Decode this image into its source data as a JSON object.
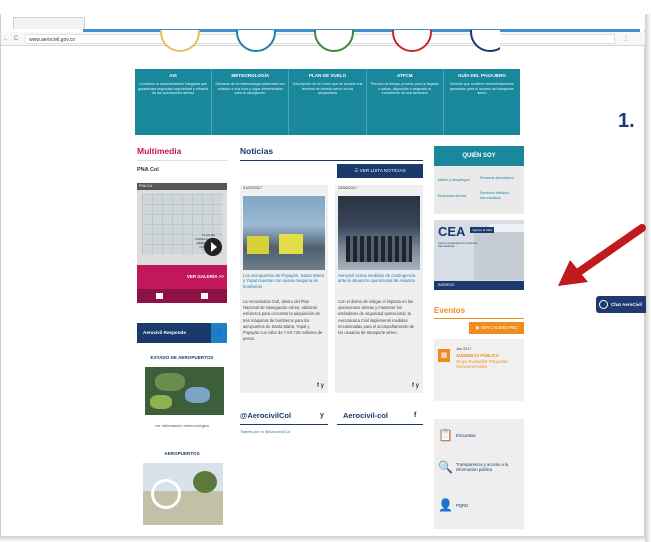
{
  "browser": {
    "url": "www.aerocivil.gov.co",
    "back_icon": "arrow-left",
    "refresh_icon": "refresh",
    "menu_icon": "vertical-dots"
  },
  "nav": [
    {
      "title": "AIS",
      "text": "Conforme la documentación integrada que garantizara seguridad regularidad y eficacia de las operaciones aéreas"
    },
    {
      "title": "METEOROLOGÍA",
      "text": "Destacar de la meteorología observada con relación a una hora y lugar determinados para la navegación."
    },
    {
      "title": "PLAN DE VUELO",
      "text": "Descripción de un vuelo que se somete a la terminal de tránsito aéreo en los aeropuertos"
    },
    {
      "title": "ATFCM",
      "text": "Período de tiempo previsto para la llegada o salida, disponible o asignado al movimiento de una aeronave"
    },
    {
      "title": "GUÍA DEL PASAJERO",
      "text": "Sección que contiene recomendaciones generales para el usuario del transporte aéreo"
    }
  ],
  "multimedia": {
    "title": "Multimedia",
    "subtitle": "PNA Col",
    "video_bar": "PNA Col",
    "video_caption": "PLAN DE NAVEGACIÓN AÉREA PARA COLOMBIA",
    "gallery_label": "VER GALERÍA >>"
  },
  "aerocivil_responde": "Aerocivil Responde",
  "estado": "ESTADO DE AEROPUERTOS",
  "ver_meteo": "ver información meteorológica",
  "aeropuertos": "AEROPUERTOS",
  "news": {
    "title": "Noticias",
    "button": "VER LISTA NOTICIAS",
    "items": [
      {
        "date": "01/03/2017",
        "headline": "Los aeropuertos de Popayán, Santa Marta y Yopal cuentan con nueva maquina de bomberos",
        "body": "La Aeronáutica Civil, dentro del Plan Nacional de Navegación Aérea, adelantó esfuerzos para concretar la adquisición de tres máquinas de bomberos para los aeropuertos de Santa Marta, Yopal y Popayán con valor de 7 mil 725 millones de pesos.",
        "share": "f y"
      },
      {
        "date": "23/06/2017",
        "headline": "Aerocivil activa medidas de contingencia ante la situación operacional de Avianca",
        "body": "Con el ánimo de mitigar el impacto en las operaciones aéreas y mantener los estándares de seguridad operacional, la Aeronáutica Civil implementó medidas encaminadas para el acompañamiento de los usuarios de transporte aéreo.",
        "share": "f y"
      }
    ]
  },
  "twitter": {
    "title": "@AerocivilCol",
    "sub": "Tweets por el @AerocivilCol",
    "icon": "y"
  },
  "facebook": {
    "title": "Aerocivil-col",
    "icon": "f"
  },
  "quien_soy": {
    "title": "QUIÉN SOY",
    "items": [
      "Misión y despliegue",
      "Personal aeronáutico",
      "Empresas Aéreas",
      "Servicios Médicos Aeronáuticos"
    ]
  },
  "cea": {
    "logo": "CEA",
    "tag": "Ingreso al CEA",
    "sub": "Centro de Estudios de Ciencias Aeronáuticas",
    "ingreso": "INGRESO"
  },
  "eventos": {
    "title": "Eventos",
    "button": "VER CALENDARIO",
    "date": "Jan 2017",
    "t1": "AUDIENCIA PÚBLICA",
    "t2": "Grupo Evaluador Proyectos Aerocomerciales"
  },
  "links": [
    {
      "text": "Encuestas"
    },
    {
      "text": "Transparencia y acceso a la información pública"
    },
    {
      "text": "PQRD"
    }
  ],
  "slide": {
    "number": "1.",
    "chat_label": "Chat AeroCivil"
  },
  "colors": {
    "teal": "#19879c",
    "magenta": "#c2185b",
    "navy": "#1a3a6b",
    "orange": "#f08c1e",
    "arrow": "#c0191e"
  }
}
